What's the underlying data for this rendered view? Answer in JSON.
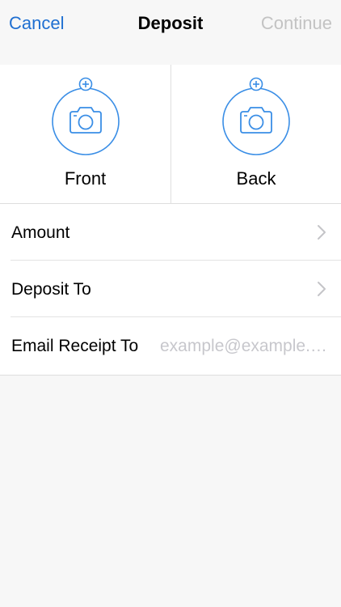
{
  "nav": {
    "cancel_label": "Cancel",
    "title": "Deposit",
    "continue_label": "Continue"
  },
  "capture": {
    "front_label": "Front",
    "back_label": "Back"
  },
  "form": {
    "amount_label": "Amount",
    "deposit_to_label": "Deposit To",
    "email_label": "Email Receipt To",
    "email_placeholder": "example@example.com",
    "email_value": ""
  },
  "colors": {
    "accent": "#1f6fd1",
    "disabled": "#c3c3c3",
    "icon_blue": "#3a8ee6",
    "background": "#f7f7f7",
    "separator": "#dedede",
    "placeholder": "#c7c7cc"
  },
  "icons": {
    "camera": "camera-icon",
    "add": "plus-icon",
    "chevron": "chevron-right-icon"
  }
}
